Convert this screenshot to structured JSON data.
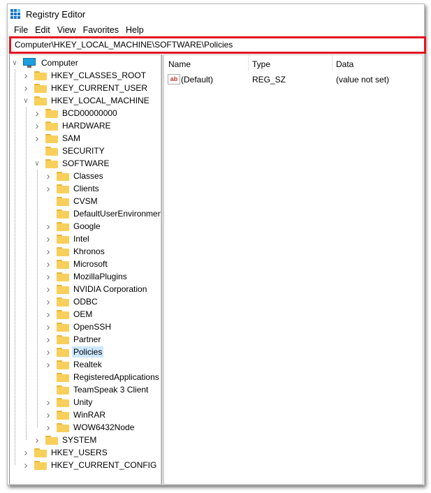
{
  "window": {
    "title": "Registry Editor"
  },
  "menu": [
    "File",
    "Edit",
    "View",
    "Favorites",
    "Help"
  ],
  "address": {
    "path": "Computer\\HKEY_LOCAL_MACHINE\\SOFTWARE\\Policies",
    "highlight_color": "#e0151f"
  },
  "columns": [
    "Name",
    "Type",
    "Data"
  ],
  "values": [
    {
      "name": "(Default)",
      "type": "REG_SZ",
      "data": "(value not set)",
      "icon": "string-value-icon"
    }
  ],
  "tree": [
    {
      "label": "Computer",
      "depth": 0,
      "chevron": "expanded",
      "icon": "computer-icon"
    },
    {
      "label": "HKEY_CLASSES_ROOT",
      "depth": 1,
      "chevron": "collapsed"
    },
    {
      "label": "HKEY_CURRENT_USER",
      "depth": 1,
      "chevron": "collapsed"
    },
    {
      "label": "HKEY_LOCAL_MACHINE",
      "depth": 1,
      "chevron": "expanded"
    },
    {
      "label": "BCD00000000",
      "depth": 2,
      "chevron": "collapsed"
    },
    {
      "label": "HARDWARE",
      "depth": 2,
      "chevron": "collapsed"
    },
    {
      "label": "SAM",
      "depth": 2,
      "chevron": "collapsed"
    },
    {
      "label": "SECURITY",
      "depth": 2,
      "chevron": "none"
    },
    {
      "label": "SOFTWARE",
      "depth": 2,
      "chevron": "expanded"
    },
    {
      "label": "Classes",
      "depth": 3,
      "chevron": "collapsed"
    },
    {
      "label": "Clients",
      "depth": 3,
      "chevron": "collapsed"
    },
    {
      "label": "CVSM",
      "depth": 3,
      "chevron": "none"
    },
    {
      "label": "DefaultUserEnvironment",
      "depth": 3,
      "chevron": "none"
    },
    {
      "label": "Google",
      "depth": 3,
      "chevron": "collapsed"
    },
    {
      "label": "Intel",
      "depth": 3,
      "chevron": "collapsed"
    },
    {
      "label": "Khronos",
      "depth": 3,
      "chevron": "collapsed"
    },
    {
      "label": "Microsoft",
      "depth": 3,
      "chevron": "collapsed"
    },
    {
      "label": "MozillaPlugins",
      "depth": 3,
      "chevron": "collapsed"
    },
    {
      "label": "NVIDIA Corporation",
      "depth": 3,
      "chevron": "collapsed"
    },
    {
      "label": "ODBC",
      "depth": 3,
      "chevron": "collapsed"
    },
    {
      "label": "OEM",
      "depth": 3,
      "chevron": "collapsed"
    },
    {
      "label": "OpenSSH",
      "depth": 3,
      "chevron": "collapsed"
    },
    {
      "label": "Partner",
      "depth": 3,
      "chevron": "collapsed"
    },
    {
      "label": "Policies",
      "depth": 3,
      "chevron": "collapsed",
      "selected": true
    },
    {
      "label": "Realtek",
      "depth": 3,
      "chevron": "collapsed"
    },
    {
      "label": "RegisteredApplications",
      "depth": 3,
      "chevron": "none"
    },
    {
      "label": "TeamSpeak 3 Client",
      "depth": 3,
      "chevron": "none"
    },
    {
      "label": "Unity",
      "depth": 3,
      "chevron": "collapsed"
    },
    {
      "label": "WinRAR",
      "depth": 3,
      "chevron": "collapsed"
    },
    {
      "label": "WOW6432Node",
      "depth": 3,
      "chevron": "collapsed"
    },
    {
      "label": "SYSTEM",
      "depth": 2,
      "chevron": "collapsed"
    },
    {
      "label": "HKEY_USERS",
      "depth": 1,
      "chevron": "collapsed"
    },
    {
      "label": "HKEY_CURRENT_CONFIG",
      "depth": 1,
      "chevron": "collapsed"
    }
  ],
  "colors": {
    "selection": "#cce8ff",
    "folder": "#f8cf5a",
    "accent": "#1a73c8"
  }
}
